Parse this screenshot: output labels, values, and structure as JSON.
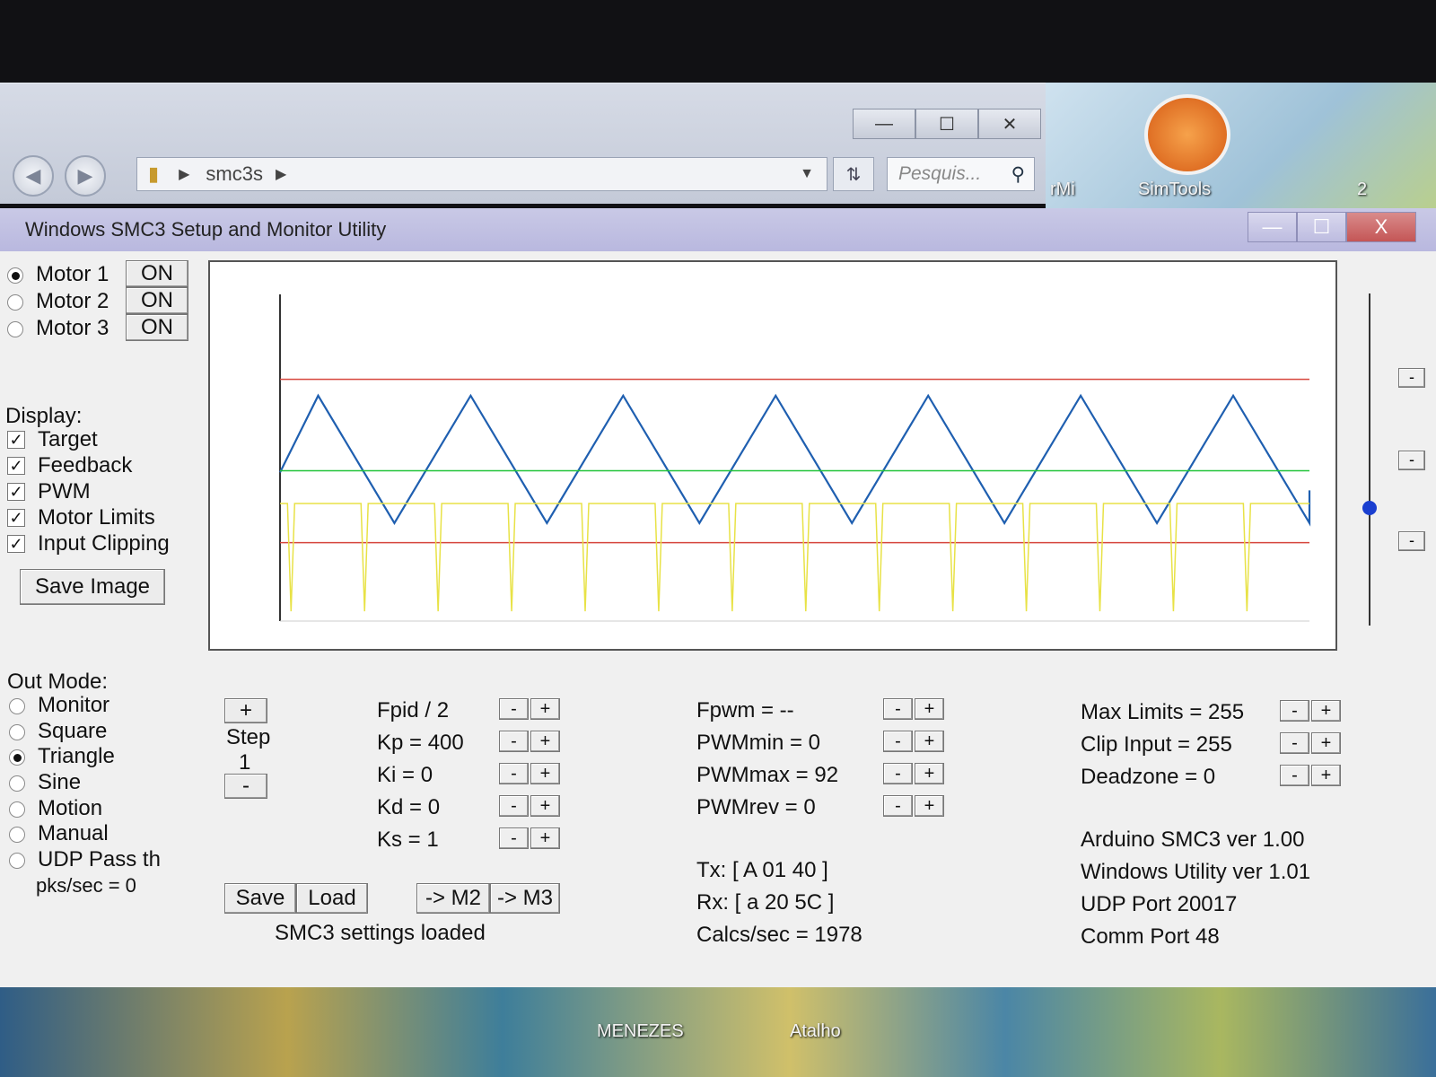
{
  "explorer": {
    "path_folder": "smc3s",
    "search_placeholder": "Pesquis...",
    "window_buttons": [
      "—",
      "☐",
      "✕"
    ]
  },
  "desktop": {
    "icon_labels": [
      "SimTools",
      "rMi",
      "2"
    ],
    "bottom_labels": [
      "MENEZES",
      "Atalho"
    ]
  },
  "app": {
    "title": "Windows SMC3 Setup and Monitor Utility",
    "window_buttons": [
      "—",
      "☐",
      "X"
    ],
    "motors": [
      {
        "label": "Motor 1",
        "state": "ON",
        "selected": true
      },
      {
        "label": "Motor 2",
        "state": "ON",
        "selected": false
      },
      {
        "label": "Motor 3",
        "state": "ON",
        "selected": false
      }
    ],
    "display": {
      "heading": "Display:",
      "options": [
        {
          "label": "Target",
          "checked": true
        },
        {
          "label": "Feedback",
          "checked": true
        },
        {
          "label": "PWM",
          "checked": true
        },
        {
          "label": "Motor Limits",
          "checked": true
        },
        {
          "label": "Input Clipping",
          "checked": true
        }
      ],
      "save_image": "Save Image"
    },
    "out_mode": {
      "heading": "Out Mode:",
      "options": [
        {
          "label": "Monitor",
          "selected": false
        },
        {
          "label": "Square",
          "selected": false
        },
        {
          "label": "Triangle",
          "selected": true
        },
        {
          "label": "Sine",
          "selected": false
        },
        {
          "label": "Motion",
          "selected": false
        },
        {
          "label": "Manual",
          "selected": false
        },
        {
          "label": "UDP Pass th",
          "selected": false
        }
      ],
      "pkts": "pks/sec = 0"
    },
    "step": {
      "plus": "+",
      "label": "Step",
      "value": "1",
      "minus": "-"
    },
    "pid": {
      "fpid": "Fpid / 2",
      "kp": "Kp = 400",
      "ki": "Ki = 0",
      "kd": "Kd = 0",
      "ks": "Ks = 1"
    },
    "pwm": {
      "fpwm": "Fpwm = --",
      "pwmmin": "PWMmin = 0",
      "pwmmax": "PWMmax = 92",
      "pwmrev": "PWMrev = 0"
    },
    "limits": {
      "max_limits": "Max Limits = 255",
      "clip_input": "Clip Input = 255",
      "deadzone": "Deadzone = 0"
    },
    "buttons": {
      "save": "Save",
      "load": "Load",
      "to_m2": "-> M2",
      "to_m3": "-> M3",
      "minus": "-",
      "plus": "+"
    },
    "status": "SMC3 settings loaded",
    "comm": {
      "tx": "Tx: [ A 01 40 ]",
      "rx": "Rx: [ a 20 5C ]",
      "calcs": "Calcs/sec = 1978"
    },
    "info": {
      "arduino": "Arduino SMC3 ver 1.00",
      "windows": "Windows Utility ver 1.01",
      "udp": "UDP Port 20017",
      "comm_port": "Comm Port 48"
    }
  },
  "chart_data": {
    "type": "line",
    "xlim": [
      0,
      1
    ],
    "ylim": [
      0,
      1
    ],
    "series": [
      {
        "color": "#1f5fb0",
        "shape": "triangle",
        "periods": 6.75,
        "min": 0.3,
        "max": 0.69
      },
      {
        "color": "#22c43a",
        "shape": "flat",
        "value": 0.46
      },
      {
        "color": "#d6453c",
        "shape": "flat",
        "value": 0.74
      },
      {
        "color": "#d6453c",
        "shape": "flat",
        "value": 0.24
      },
      {
        "color": "#e8e246",
        "shape": "spikes",
        "baseline": 0.36,
        "spike_to": 0.03,
        "spike_count": 14
      }
    ],
    "grid": false
  },
  "colors": {
    "titlebar": "#c9c9e6",
    "window_bg": "#f0f0f0",
    "scope_bg": "#ffffff",
    "slider_thumb": "#1a3fd0"
  }
}
